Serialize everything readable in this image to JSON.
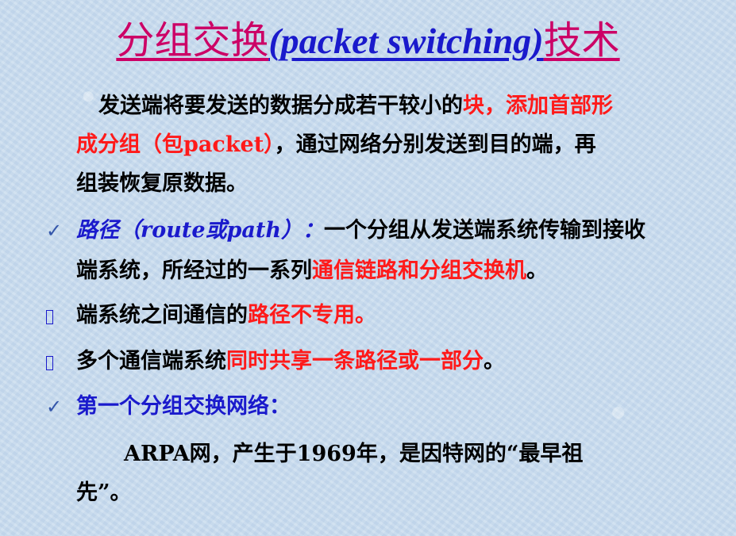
{
  "title": {
    "pre": "分组交换",
    "en": "(packet switching)",
    "post": "技术"
  },
  "para1": {
    "line1_normal": "发送端将要发送的数据分成若干较小的",
    "line1_red": "块，添加首部形",
    "line2_red": "成分组（包packet）",
    "line2_normal": "，通过网络分别发送到目的端，再",
    "line3": "组装恢复原数据。"
  },
  "bullet1": {
    "marker": "✓",
    "term": "路径（route或path）：",
    "line1_rest": "一个分组从发送端系统传输到接收",
    "line2_normal": "端系统，所经过的一系列",
    "line2_red": "通信链路和分组交换机",
    "line2_end": "。"
  },
  "bullet2": {
    "normal": "端系统之间通信的",
    "red": "路径不专用。"
  },
  "bullet3": {
    "normal": "多个通信端系统",
    "red": "同时共享一条路径或一部分",
    "end": "。"
  },
  "bullet4": {
    "marker": "✓",
    "text": "第一个分组交换网络："
  },
  "para2": {
    "line1": "ARPA网，产生于1969年，是因特网的“最早祖",
    "line2": "先”。"
  }
}
